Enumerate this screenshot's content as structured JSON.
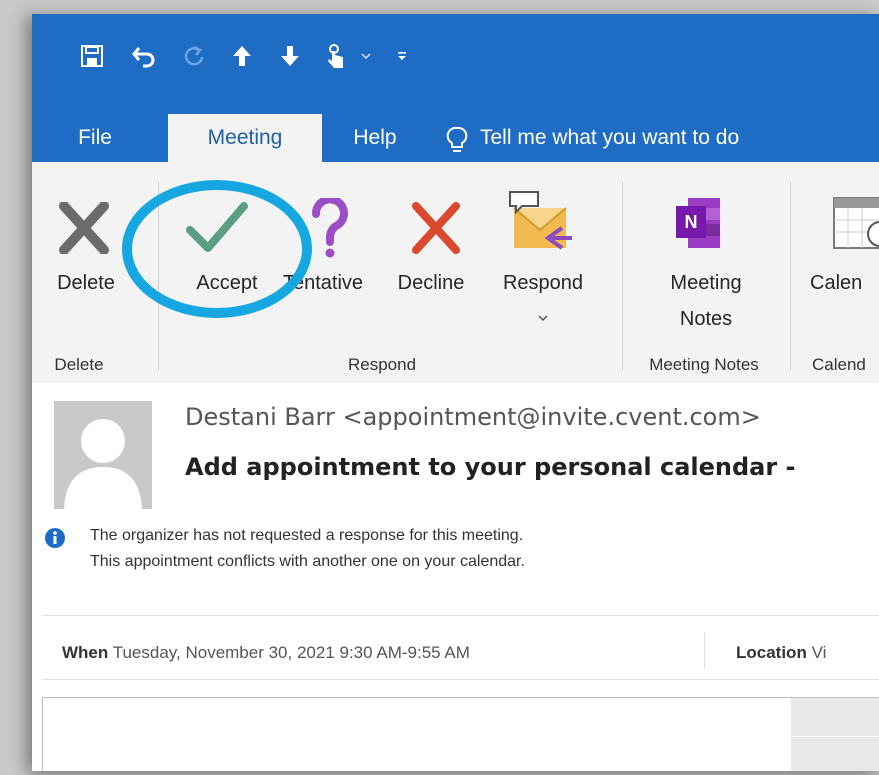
{
  "quick_access": {
    "icons": [
      "save-icon",
      "undo-icon",
      "redo-icon",
      "up-arrow-icon",
      "down-arrow-icon",
      "touch-mode-icon",
      "dropdown-chevron-icon",
      "customize-qat-icon"
    ]
  },
  "tabs": [
    {
      "label": "File",
      "active": false
    },
    {
      "label": "Meeting",
      "active": true
    },
    {
      "label": "Help",
      "active": false
    }
  ],
  "tell_me": {
    "placeholder": "Tell me what you want to do"
  },
  "ribbon": {
    "delete_group": {
      "button": "Delete",
      "label": "Delete"
    },
    "respond_group": {
      "label": "Respond",
      "accept": "Accept",
      "tentative": "Tentative",
      "decline": "Decline",
      "respond": "Respond"
    },
    "notes_group": {
      "button_line1": "Meeting",
      "button_line2": "Notes",
      "label": "Meeting Notes"
    },
    "calendar_group": {
      "button": "Calen",
      "label": "Calend"
    }
  },
  "message": {
    "sender": "Destani Barr <appointment@invite.cvent.com>",
    "subject": "Add appointment to your personal calendar -",
    "info_line1": "The organizer has not requested a response for this meeting.",
    "info_line2": "This appointment conflicts with another one on your calendar.",
    "when_label": "When",
    "when_value": "Tuesday, November 30, 2021 9:30 AM-9:55 AM",
    "location_label": "Location",
    "location_value": "Vi"
  },
  "colors": {
    "title_bar": "#1f6cc5",
    "highlight": "#16a7e0",
    "accept_green": "#5a9e84",
    "decline_red": "#d84a2b",
    "tentative_purple": "#9c4ec7"
  }
}
